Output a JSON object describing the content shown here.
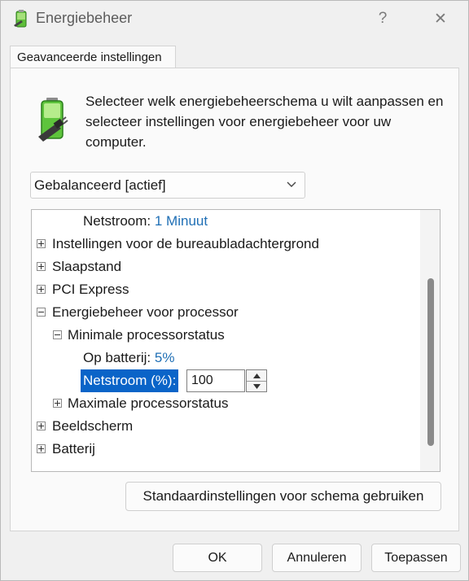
{
  "window": {
    "title": "Energiebeheer",
    "help_label": "?",
    "close_label": "✕"
  },
  "tab": {
    "label": "Geavanceerde instellingen"
  },
  "description": "Selecteer welk energiebeheerschema u wilt aanpassen en selecteer instellingen voor energiebeheer voor uw computer.",
  "plan": {
    "selected": "Gebalanceerd [actief]"
  },
  "tree": {
    "partial_row": {
      "label": "Netstroom:",
      "value": "1 Minuut"
    },
    "items": {
      "desktop_background": "Instellingen voor de bureaubladachtergrond",
      "sleep": "Slaapstand",
      "pci_express": "PCI Express",
      "processor_power": "Energiebeheer voor processor",
      "min_processor_state": "Minimale processorstatus",
      "on_battery_label": "Op batterij:",
      "on_battery_value": "5%",
      "plugged_in_label": "Netstroom (%):",
      "plugged_in_value": "100",
      "max_processor_state": "Maximale processorstatus",
      "display": "Beeldscherm",
      "battery": "Batterij"
    }
  },
  "restore_defaults_label": "Standaardinstellingen voor schema gebruiken",
  "buttons": {
    "ok": "OK",
    "cancel": "Annuleren",
    "apply": "Toepassen"
  },
  "colors": {
    "accent": "#0a64c8",
    "value_text": "#1f6fb5"
  },
  "icons": [
    "battery-plug-icon",
    "help-icon",
    "close-icon",
    "chevron-down-icon",
    "expand-icon",
    "collapse-icon",
    "spin-up-icon",
    "spin-down-icon"
  ]
}
